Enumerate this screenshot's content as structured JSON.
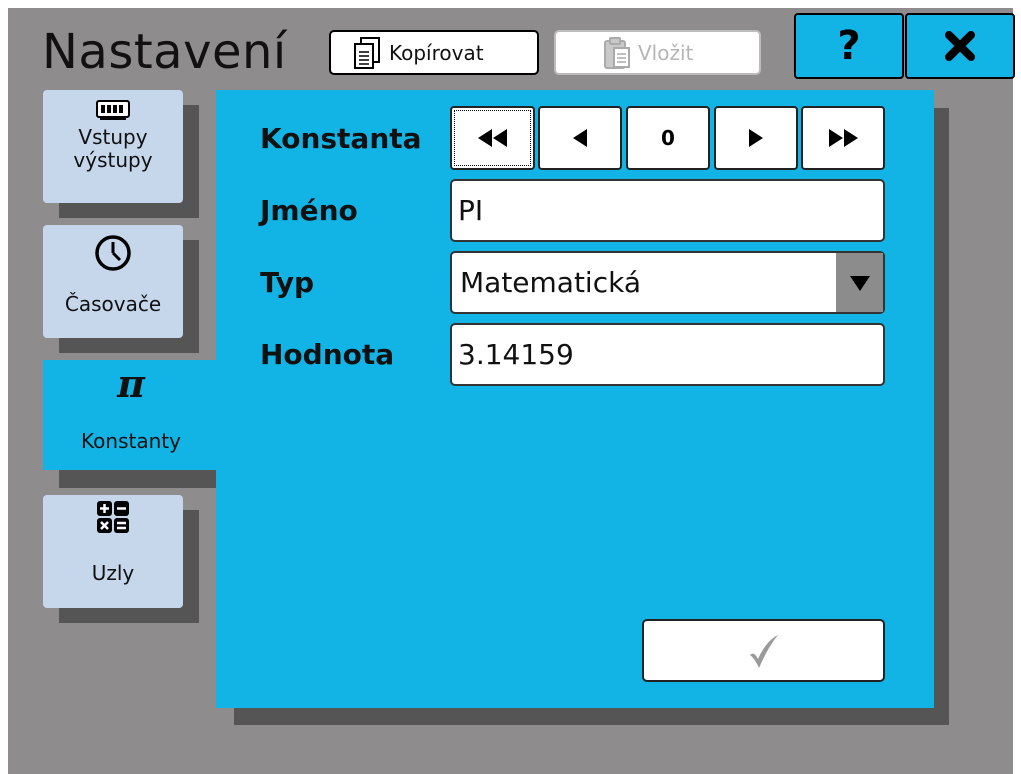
{
  "app": {
    "title": "Nastavení"
  },
  "toolbar": {
    "copy_label": "Kopírovat",
    "paste_label": "Vložit"
  },
  "header": {
    "help_label": "?"
  },
  "tabs": [
    {
      "label": "Vstupy\nvýstupy",
      "icon": "io-module-icon"
    },
    {
      "label": "Časovače",
      "icon": "clock-icon"
    },
    {
      "label": "Konstanty",
      "icon": "pi-icon",
      "glyph": "π",
      "active": true
    },
    {
      "label": "Uzly",
      "icon": "math-operators-icon"
    }
  ],
  "form": {
    "constant_label": "Konstanta",
    "constant_index": "0",
    "name_label": "Jméno",
    "name_value": "PI",
    "type_label": "Typ",
    "type_value": "Matematická",
    "value_label": "Hodnota",
    "value_value": "3.14159"
  },
  "colors": {
    "accent": "#12b4e6",
    "background": "#8f8c8d",
    "tab_inactive": "#c6d7ec"
  }
}
